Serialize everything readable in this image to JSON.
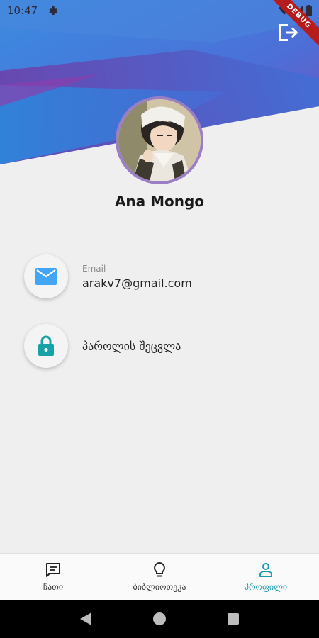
{
  "status_bar": {
    "time": "10:47"
  },
  "debug_banner": "DEBUG",
  "profile": {
    "name": "Ana Mongo"
  },
  "email": {
    "label": "Email",
    "value": "arakv7@gmail.com"
  },
  "password": {
    "label": "პაროლის შეცვლა"
  },
  "bottom_nav": {
    "items": [
      {
        "label": "ჩათი",
        "icon": "chat-icon"
      },
      {
        "label": "ბიბლიოთეკა",
        "icon": "lightbulb-icon"
      },
      {
        "label": "პროფილი",
        "icon": "person-icon"
      }
    ],
    "active_index": 2
  },
  "colors": {
    "accent": "#1c9bb0",
    "email_icon": "#42A5F5",
    "lock_icon": "#17A2A8",
    "header_blue": "#2E7FD8",
    "header_purple": "#6A3FA6"
  }
}
